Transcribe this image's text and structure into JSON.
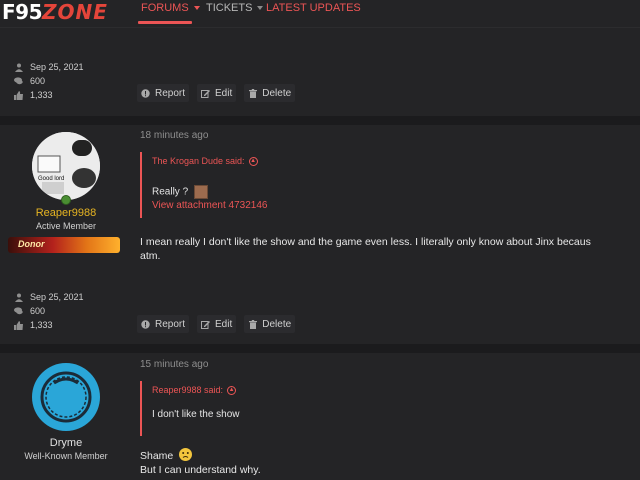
{
  "logo": {
    "part1": "F95",
    "part2": "ZONE"
  },
  "nav": {
    "tabs": [
      {
        "label": "FORUMS"
      },
      {
        "label": "TICKETS"
      },
      {
        "label": "LATEST UPDATES"
      }
    ]
  },
  "posts": [
    {
      "stats": {
        "joined": "Sep 25, 2021",
        "messages": "600",
        "reactions": "1,333"
      },
      "actions": {
        "report": "Report",
        "edit": "Edit",
        "delete": "Delete"
      }
    },
    {
      "time": "18 minutes ago",
      "user": {
        "name": "Reaper9988",
        "title": "Active Member",
        "badge": "Donor",
        "avatar_text": "Good lord"
      },
      "quote": {
        "author": "The Krogan Dude said:",
        "text": "Really ?",
        "link": "View attachment 4732146"
      },
      "body": [
        "I mean really I don't like the show and the game even less. I literally only know about Jinx becaus",
        "atm."
      ],
      "stats": {
        "joined": "Sep 25, 2021",
        "messages": "600",
        "reactions": "1,333"
      },
      "actions": {
        "report": "Report",
        "edit": "Edit",
        "delete": "Delete"
      }
    },
    {
      "time": "15 minutes ago",
      "user": {
        "name": "Dryme",
        "title": "Well-Known Member"
      },
      "quote": {
        "author": "Reaper9988 said:",
        "text": "I don't like the show"
      },
      "body": [
        "Shame",
        "But I can understand why."
      ]
    }
  ],
  "colors": {
    "accent": "#ec5555",
    "background": "#1d1d1f",
    "panel": "#242426",
    "username_gold": "#e6b422",
    "avatar_blue": "#2aa6d8"
  },
  "icons": {
    "joined": "user-icon",
    "messages": "comments-icon",
    "reactions": "thumbs-up-icon",
    "report": "report-icon",
    "edit": "edit-icon",
    "delete": "trash-icon"
  }
}
